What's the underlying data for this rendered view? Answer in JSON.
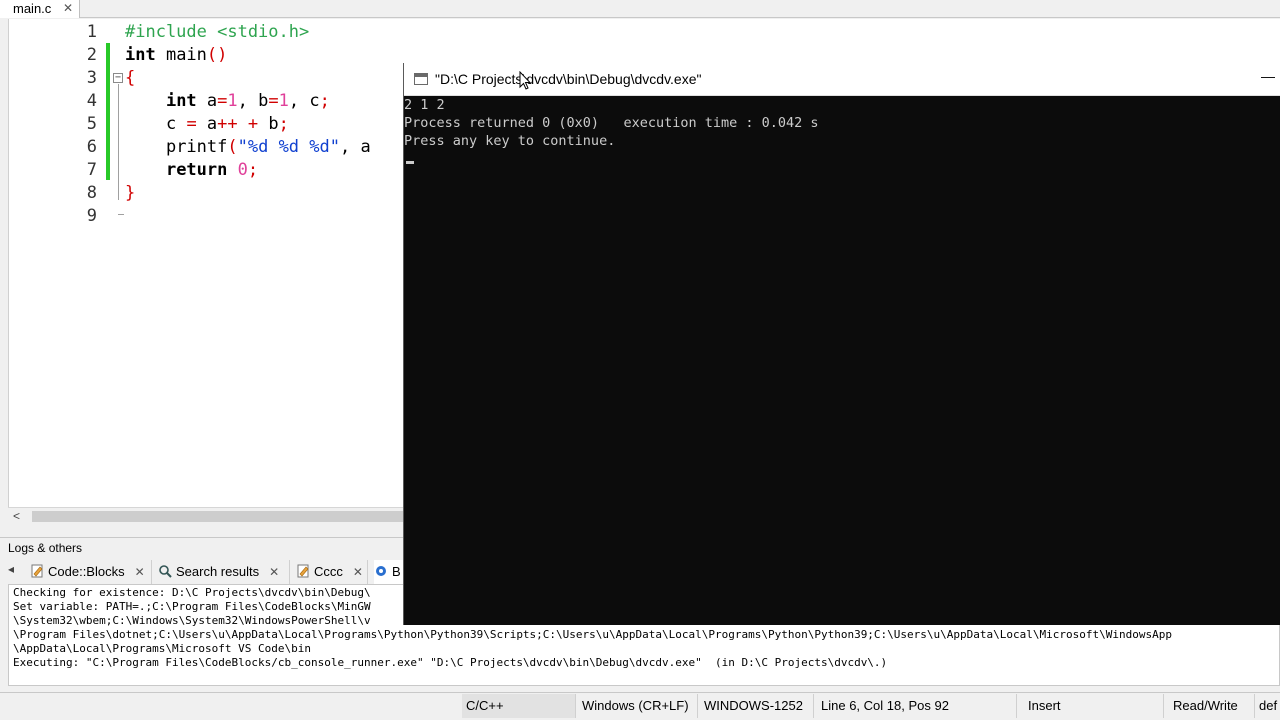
{
  "editor": {
    "tab_label": "main.c",
    "tab_close": "✕",
    "line_numbers": [
      "1",
      "2",
      "3",
      "4",
      "5",
      "6",
      "7",
      "8",
      "9"
    ],
    "code": {
      "l1": "#include <stdio.h>",
      "l2_kw": "int",
      "l2_rest": " main",
      "l2_parens": "()",
      "l3_brace": "{",
      "l4_indent": "    ",
      "l4_kw": "int",
      "l4_a": " a",
      "l4_eq1": "=",
      "l4_n1": "1",
      "l4_sep1": ", b",
      "l4_eq2": "=",
      "l4_n2": "1",
      "l4_rest": ", c",
      "l4_semi": ";",
      "l5_indent": "    ",
      "l5_c": "c ",
      "l5_eq": "=",
      "l5_a": " a",
      "l5_inc": "++",
      "l5_sp": " ",
      "l5_plus": "+",
      "l5_b": " b",
      "l5_semi": ";",
      "l6_indent": "    ",
      "l6_fn": "printf",
      "l6_paren": "(",
      "l6_str": "\"%d %d %d\"",
      "l6_comma": ", a",
      "l7_indent": "    ",
      "l7_kw": "return",
      "l7_sp": " ",
      "l7_num": "0",
      "l7_semi": ";",
      "l8_brace": "}"
    },
    "scroll_left": "<"
  },
  "console": {
    "title": "\"D:\\C Projects\\dvcdv\\bin\\Debug\\dvcdv.exe\"",
    "minimize": "—",
    "output": [
      "2 1 2",
      "Process returned 0 (0x0)   execution time : 0.042 s",
      "Press any key to continue."
    ]
  },
  "logs": {
    "title": "Logs & others",
    "tab_arrow": "◂",
    "tabs": [
      {
        "label": "Code::Blocks",
        "close": "✕"
      },
      {
        "label": "Search results",
        "close": "✕"
      },
      {
        "label": "Cccc",
        "close": "✕"
      },
      {
        "label": "B",
        "close": ""
      }
    ],
    "lines": [
      "Checking for existence: D:\\C Projects\\dvcdv\\bin\\Debug\\",
      "Set variable: PATH=.;C:\\Program Files\\CodeBlocks\\MinGW",
      "\\System32\\wbem;C:\\Windows\\System32\\WindowsPowerShell\\v",
      "\\Program Files\\dotnet;C:\\Users\\u\\AppData\\Local\\Programs\\Python\\Python39\\Scripts;C:\\Users\\u\\AppData\\Local\\Programs\\Python\\Python39;C:\\Users\\u\\AppData\\Local\\Microsoft\\WindowsApp",
      "\\AppData\\Local\\Programs\\Microsoft VS Code\\bin",
      "Executing: \"C:\\Program Files\\CodeBlocks/cb_console_runner.exe\" \"D:\\C Projects\\dvcdv\\bin\\Debug\\dvcdv.exe\"  (in D:\\C Projects\\dvcdv\\.)"
    ]
  },
  "statusbar": {
    "language": "C/C++",
    "line_endings": "Windows (CR+LF)",
    "encoding": "WINDOWS-1252",
    "position": "Line 6, Col 18, Pos 92",
    "mode": "Insert",
    "access": "Read/Write",
    "extra": "def"
  },
  "colors": {
    "preprocessor": "#2ea44f",
    "keyword": "#000000",
    "number": "#e0409a",
    "string": "#1040d0",
    "operator": "#d00000",
    "change_bar": "#28c928",
    "console_bg": "#0c0c0c",
    "console_fg": "#cccccc"
  }
}
